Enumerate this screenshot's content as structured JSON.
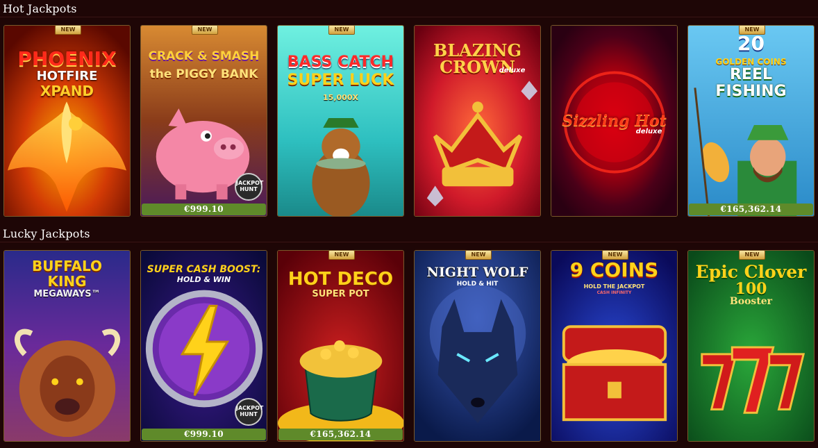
{
  "sections": [
    {
      "title": "Hot Jackpots",
      "games": [
        {
          "name": "Phoenix Hotfire Xpand",
          "title_lines": [
            "PHOENIX",
            "HOTFIRE",
            "XPAND"
          ],
          "badge": "NEW",
          "jackpot": "",
          "icon": "phoenix-icon"
        },
        {
          "name": "Crack & Smash the Piggy Bank",
          "title_lines": [
            "CRACK & SMASH",
            "the PIGGY BANK"
          ],
          "badge": "NEW",
          "jackpot": "€999.10",
          "logo": "JACKPOT HUNT",
          "icon": "piggy-bank-icon"
        },
        {
          "name": "Bass Catch Super Luck",
          "title_lines": [
            "BASS CATCH",
            "SUPER LUCK",
            "15,000X"
          ],
          "badge": "NEW",
          "jackpot": "",
          "icon": "dog-fish-icon"
        },
        {
          "name": "Blazing Crown deluxe",
          "title_lines": [
            "BLAZING",
            "CROWN",
            "deluxe"
          ],
          "badge": "",
          "jackpot": "",
          "icon": "crown-icon"
        },
        {
          "name": "Sizzling Hot deluxe",
          "title_lines": [
            "Sizzling Hot",
            "deluxe"
          ],
          "badge": "",
          "jackpot": "",
          "icon": "sizzling-hot-icon"
        },
        {
          "name": "20 Golden Coins Reel Fishing",
          "title_lines": [
            "20",
            "GOLDEN COINS",
            "REEL",
            "FISHING"
          ],
          "badge": "NEW",
          "jackpot": "€165,362.14",
          "icon": "fisherman-icon"
        }
      ]
    },
    {
      "title": "Lucky Jackpots",
      "games": [
        {
          "name": "Buffalo King Megaways",
          "title_lines": [
            "BUFFALO",
            "KING",
            "MEGAWAYS™"
          ],
          "badge": "",
          "jackpot": "",
          "icon": "buffalo-icon"
        },
        {
          "name": "Super Cash Boost: Hold & Win",
          "title_lines": [
            "SUPER CASH BOOST:",
            "HOLD & WIN"
          ],
          "badge": "",
          "jackpot": "€999.10",
          "logo": "JACKPOT HUNT",
          "icon": "lightning-icon"
        },
        {
          "name": "Hot Deco Super Pot",
          "title_lines": [
            "HOT DECO",
            "SUPER POT"
          ],
          "badge": "NEW",
          "jackpot": "€165,362.14",
          "icon": "gold-pot-icon"
        },
        {
          "name": "Night Wolf Hold & Hit",
          "title_lines": [
            "NIGHT WOLF",
            "HOLD & HIT"
          ],
          "badge": "NEW",
          "jackpot": "",
          "icon": "wolf-icon"
        },
        {
          "name": "9 Coins Hold the Jackpot",
          "title_lines": [
            "9 COINS",
            "HOLD THE JACKPOT",
            "CASH INFINITY"
          ],
          "badge": "NEW",
          "jackpot": "",
          "icon": "treasure-chest-icon"
        },
        {
          "name": "Epic Clover 100 Booster",
          "title_lines": [
            "Epic Clover",
            "100",
            "Booster"
          ],
          "badge": "NEW",
          "jackpot": "",
          "icon": "sevens-icon"
        }
      ]
    }
  ],
  "colors": {
    "page_background": "#1e0606",
    "jackpot_bar": "#5f8a2a",
    "card_border": "#7a5a2a",
    "badge_gold": "#e8c266"
  }
}
